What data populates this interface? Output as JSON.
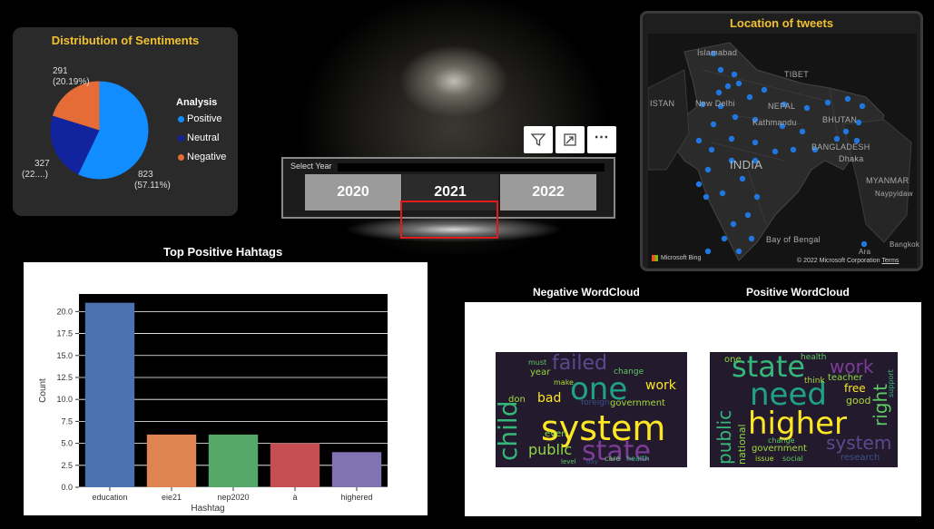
{
  "pie": {
    "title": "Distribution of Sentiments",
    "legend_title": "Analysis",
    "legend": [
      {
        "label": "Positive",
        "color": "#118dff"
      },
      {
        "label": "Neutral",
        "color": "#12239e"
      },
      {
        "label": "Negative",
        "color": "#e66c37"
      }
    ],
    "labels": {
      "negative": [
        "291",
        "(20.19%)"
      ],
      "neutral": [
        "327",
        "(22....)"
      ],
      "positive": [
        "823",
        "(57.11%)"
      ]
    }
  },
  "slicer": {
    "title": "Select Year",
    "years": [
      "2020",
      "2021",
      "2022"
    ],
    "selected": "2021"
  },
  "map": {
    "title": "Location of tweets",
    "labels": [
      "Islamabad",
      "TIBET",
      "ISTAN",
      "New Delhi",
      "NEPAL",
      "Kathmandu",
      "BHUTAN",
      "BANGLADESH",
      "Dhaka",
      "INDIA",
      "MYANMAR",
      "Naypyidaw",
      "Bay of Bengal",
      "Bangkok",
      "Ara"
    ],
    "attribution": "© 2022 Microsoft Corporation",
    "terms": "Terms",
    "bing": "Microsoft Bing",
    "marker_color": "#1f77e0"
  },
  "bar": {
    "section_title": "Top Positive Hahtags"
  },
  "chart_data": {
    "type": "bar",
    "categories": [
      "education",
      "eie21",
      "nep2020",
      "à",
      "highered"
    ],
    "values": [
      21,
      6,
      6,
      5,
      4
    ],
    "colors": [
      "#4c72b0",
      "#dd8452",
      "#55a868",
      "#c44e52",
      "#8172b3"
    ],
    "xlabel": "Hashtag",
    "ylabel": "Count",
    "ylim": [
      0,
      22
    ],
    "yticks": [
      "0.0",
      "2.5",
      "5.0",
      "7.5",
      "10.0",
      "12.5",
      "15.0",
      "17.5",
      "20.0"
    ],
    "grid": true
  },
  "wordclouds": {
    "negative_title": "Negative WordCloud",
    "positive_title": "Positive WordCloud",
    "negative_words": [
      "system",
      "state",
      "child",
      "failed",
      "one",
      "public",
      "bad",
      "work",
      "government",
      "year",
      "don",
      "even",
      "must",
      "make",
      "change",
      "foreign",
      "care",
      "health",
      "level",
      "day"
    ],
    "positive_words": [
      "state",
      "need",
      "higher",
      "work",
      "system",
      "public",
      "right",
      "national",
      "government",
      "free",
      "good",
      "teacher",
      "health",
      "support",
      "change",
      "issue",
      "social",
      "research",
      "think",
      "one"
    ]
  }
}
